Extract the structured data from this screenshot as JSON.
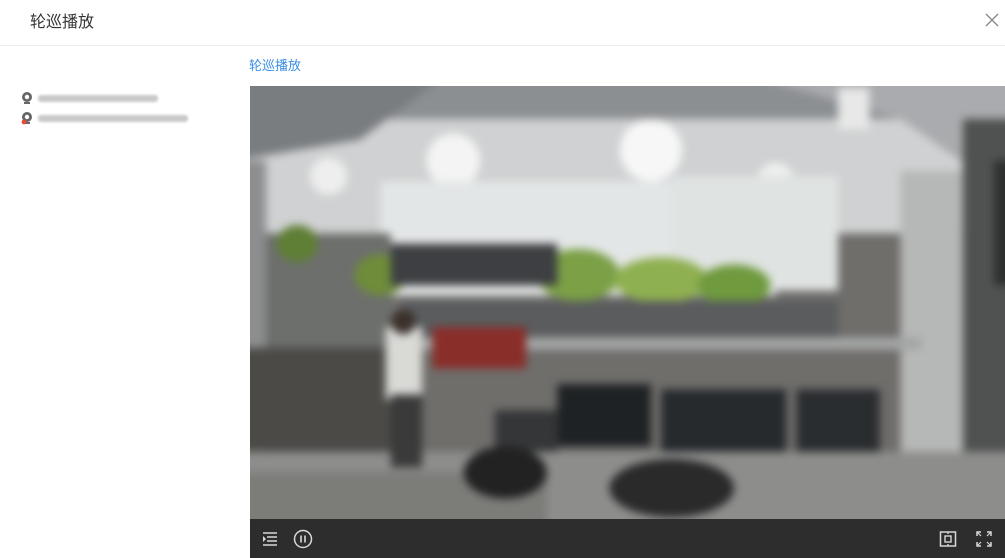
{
  "dialog": {
    "title": "轮巡播放"
  },
  "tab": {
    "label": "轮巡播放"
  },
  "camera_list": [
    {
      "label": "",
      "icon": "camera-icon",
      "status": "online"
    },
    {
      "label": "",
      "icon": "camera-icon",
      "status": "offline"
    }
  ],
  "player": {
    "controls": [
      "playlist-icon",
      "pause-icon",
      "screenshot-icon",
      "fullscreen-icon"
    ]
  },
  "colors": {
    "accent": "#3a8ee6",
    "control_bar": "#2d2d2d",
    "offline_badge": "#e64a3b"
  }
}
